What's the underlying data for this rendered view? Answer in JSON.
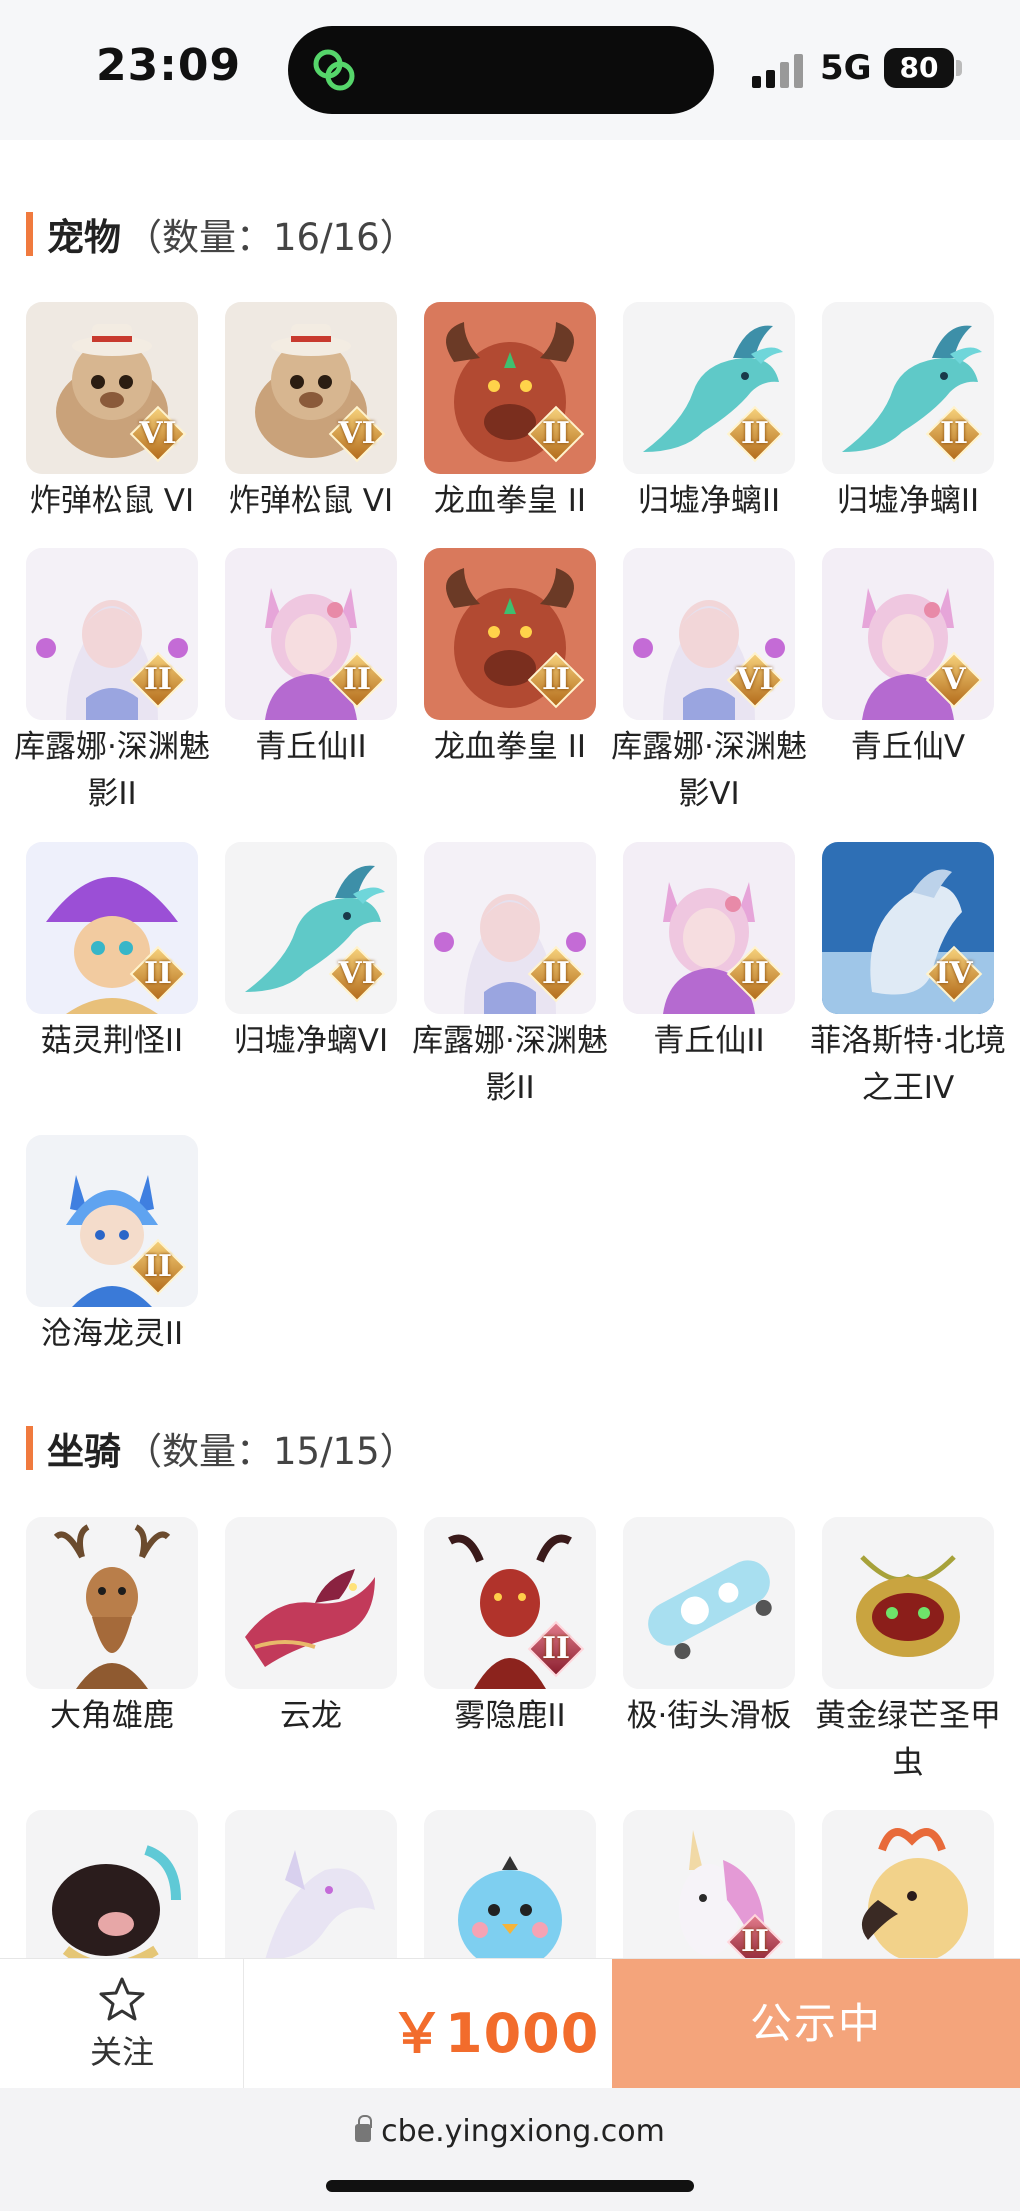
{
  "status": {
    "time": "23:09",
    "network": "5G",
    "battery": "80"
  },
  "pets": {
    "title": "宠物",
    "count": "（数量：16/16）",
    "items": [
      {
        "name": "炸弹松鼠 VI",
        "rank": "VI",
        "art": "squirrel"
      },
      {
        "name": "炸弹松鼠 VI",
        "rank": "VI",
        "art": "squirrel"
      },
      {
        "name": "龙血拳皇 II",
        "rank": "II",
        "art": "minotaur"
      },
      {
        "name": "归墟净螭II",
        "rank": "II",
        "art": "dragon"
      },
      {
        "name": "归墟净螭II",
        "rank": "II",
        "art": "dragon"
      },
      {
        "name": "库露娜·深渊魅影II",
        "rank": "II",
        "art": "kuluna"
      },
      {
        "name": "青丘仙II",
        "rank": "II",
        "art": "fox"
      },
      {
        "name": "龙血拳皇 II",
        "rank": "II",
        "art": "minotaur"
      },
      {
        "name": "库露娜·深渊魅影VI",
        "rank": "VI",
        "art": "kuluna"
      },
      {
        "name": "青丘仙V",
        "rank": "V",
        "art": "fox"
      },
      {
        "name": "菇灵荆怪II",
        "rank": "II",
        "art": "mushroom"
      },
      {
        "name": "归墟净螭VI",
        "rank": "VI",
        "art": "dragon"
      },
      {
        "name": "库露娜·深渊魅影II",
        "rank": "II",
        "art": "kuluna"
      },
      {
        "name": "青丘仙II",
        "rank": "II",
        "art": "fox"
      },
      {
        "name": "菲洛斯特·北境之王IV",
        "rank": "IV",
        "art": "frost"
      },
      {
        "name": "沧海龙灵II",
        "rank": "II",
        "art": "bluekid"
      }
    ]
  },
  "mounts": {
    "title": "坐骑",
    "count": "（数量：15/15）",
    "items": [
      {
        "name": "大角雄鹿",
        "rank": "",
        "art": "deer"
      },
      {
        "name": "云龙",
        "rank": "",
        "art": "clouddragon"
      },
      {
        "name": "雾隐鹿II",
        "rank": "II",
        "art": "reddeer"
      },
      {
        "name": "极·街头滑板",
        "rank": "",
        "art": "skateboard"
      },
      {
        "name": "黄金绿芒圣甲虫",
        "rank": "",
        "art": "beetle"
      },
      {
        "name": "",
        "rank": "",
        "art": "pig"
      },
      {
        "name": "",
        "rank": "",
        "art": "whitedragon"
      },
      {
        "name": "",
        "rank": "",
        "art": "bird"
      },
      {
        "name": "",
        "rank": "II",
        "art": "unicorn"
      },
      {
        "name": "",
        "rank": "",
        "art": "eagle"
      }
    ]
  },
  "actions": {
    "follow_label": "关注",
    "price": "￥1000",
    "status_button": "公示中"
  },
  "browser": {
    "url": "cbe.yingxiong.com"
  }
}
